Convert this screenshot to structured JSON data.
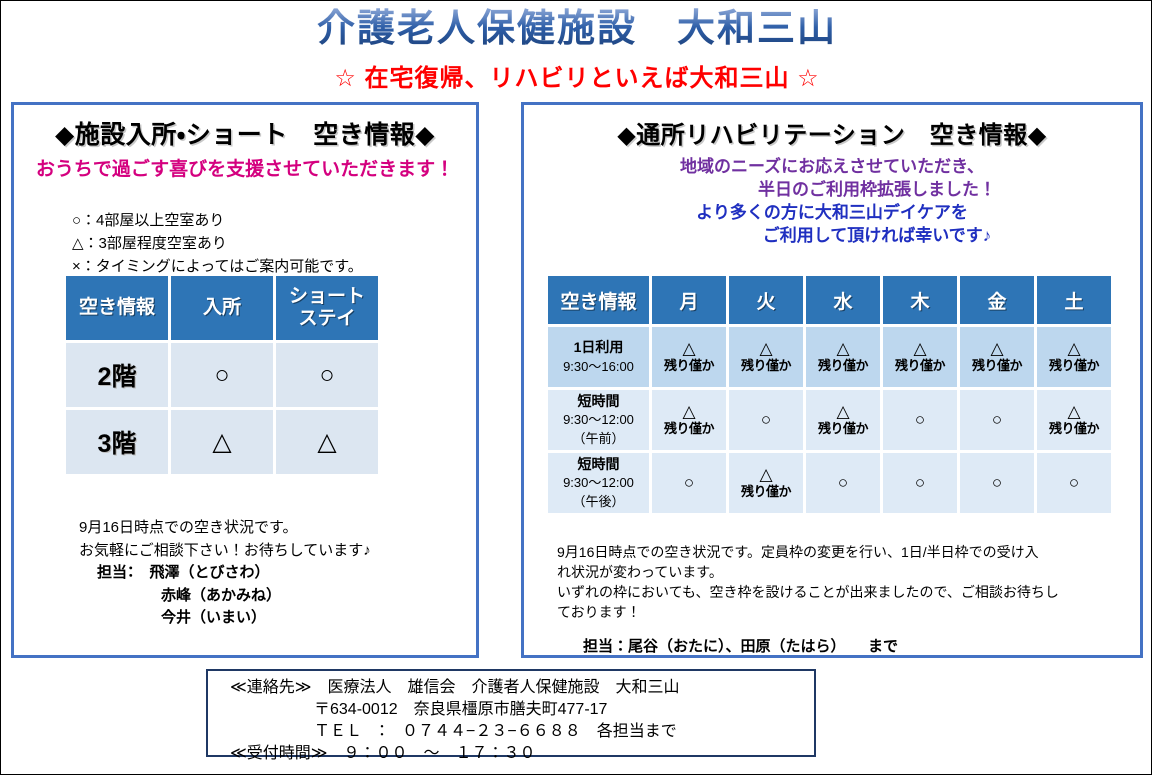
{
  "header": {
    "main_title": "介護老人保健施設　大和三山",
    "sub_title": "☆ 在宅復帰、リハビリといえば大和三山 ☆",
    "title_gradient_from": "#8fa9d8",
    "title_gradient_to": "#1b3f78",
    "sub_title_color": "#ff0000"
  },
  "left_panel": {
    "heading": "◆施設入所・ショート　空き情報◆",
    "tagline": "おうちで過ごす喜びを支援させていただきます！",
    "tagline_color": "#d4007f",
    "legend": [
      "○：4部屋以上空室あり",
      "△：3部屋程度空室あり",
      "×：タイミングによってはご案内可能です。"
    ],
    "table": {
      "headers": [
        "空き情報",
        "入所",
        "ショート\nステイ"
      ],
      "header_col1": "空き情報",
      "header_col2": "入所",
      "header_col3_line1": "ショート",
      "header_col3_line2": "ステイ",
      "rows": [
        {
          "label": "2階",
          "nyusho": "○",
          "short_stay": "○"
        },
        {
          "label": "3階",
          "nyusho": "△",
          "short_stay": "△"
        }
      ],
      "header_bg": "#2e75b6",
      "cell_bg": "#dce6f1"
    },
    "footer": {
      "line1": "9月16日時点での空き状況です。",
      "line2": "お気軽にご相談下さい！お待ちしています♪",
      "staff_label": "担当：　飛澤（とびさわ）",
      "staff_2": "赤峰（あかみね）",
      "staff_3": "今井（いまい）"
    }
  },
  "right_panel": {
    "heading": "◆通所リハビリテーション　空き情報◆",
    "tagline_lines": [
      {
        "text": "地域のニーズにお応えさせていただき、",
        "color": "#7030a0",
        "indent": false
      },
      {
        "text": "半日のご利用枠拡張しました！",
        "color": "#7030a0",
        "indent": true
      },
      {
        "text": "より多くの方に大和三山デイケアを",
        "color": "#1f2fc0",
        "indent": false
      },
      {
        "text": "ご利用して頂ければ幸いです♪",
        "color": "#1f2fc0",
        "indent": true
      }
    ],
    "table": {
      "headers": [
        "空き情報",
        "月",
        "火",
        "水",
        "木",
        "金",
        "土"
      ],
      "rows": [
        {
          "label": "1日利用",
          "time": "9:30〜16:00",
          "period": "",
          "cells": [
            {
              "mark": "△",
              "note": "残り僅か"
            },
            {
              "mark": "△",
              "note": "残り僅か"
            },
            {
              "mark": "△",
              "note": "残り僅か"
            },
            {
              "mark": "△",
              "note": "残り僅か"
            },
            {
              "mark": "△",
              "note": "残り僅か"
            },
            {
              "mark": "△",
              "note": "残り僅か"
            }
          ]
        },
        {
          "label": "短時間",
          "time": "9:30〜12:00",
          "period": "（午前）",
          "cells": [
            {
              "mark": "△",
              "note": "残り僅か"
            },
            {
              "mark": "○",
              "note": ""
            },
            {
              "mark": "△",
              "note": "残り僅か"
            },
            {
              "mark": "○",
              "note": ""
            },
            {
              "mark": "○",
              "note": ""
            },
            {
              "mark": "△",
              "note": "残り僅か"
            }
          ]
        },
        {
          "label": "短時間",
          "time": "9:30〜12:00",
          "period": "（午後）",
          "cells": [
            {
              "mark": "○",
              "note": ""
            },
            {
              "mark": "△",
              "note": "残り僅か"
            },
            {
              "mark": "○",
              "note": ""
            },
            {
              "mark": "○",
              "note": ""
            },
            {
              "mark": "○",
              "note": ""
            },
            {
              "mark": "○",
              "note": ""
            }
          ]
        }
      ],
      "header_bg": "#2e75b6",
      "row_full_bg": "#bdd7ee",
      "row_half_bg": "#deeaf6"
    },
    "footer": {
      "line1": "9月16日時点での空き状況です。定員枠の変更を行い、1日/半日枠での受け入",
      "line2": "れ状況が変わっています。",
      "line3": "いずれの枠においても、空き枠を設けることが出来ましたので、ご相談お待ちし",
      "line4": "ております！",
      "staff": "担当：尾谷（おたに）、田原（たはら）　　まで"
    }
  },
  "contact": {
    "line1": "≪連絡先≫　医療法人　雄信会　介護者人保健施設　大和三山",
    "line2": "〒634-0012　奈良県橿原市膳夫町477-17",
    "line3": "ＴＥＬ　：　０７４４−２３−６６８８　各担当まで",
    "line4": "≪受付時間≫　９：００　〜　１７：３０"
  },
  "colors": {
    "panel_border": "#4472c4",
    "table_header": "#2e75b6",
    "accent_red": "#ff0000",
    "accent_magenta": "#d4007f",
    "accent_purple": "#7030a0",
    "accent_blue": "#1f2fc0"
  }
}
